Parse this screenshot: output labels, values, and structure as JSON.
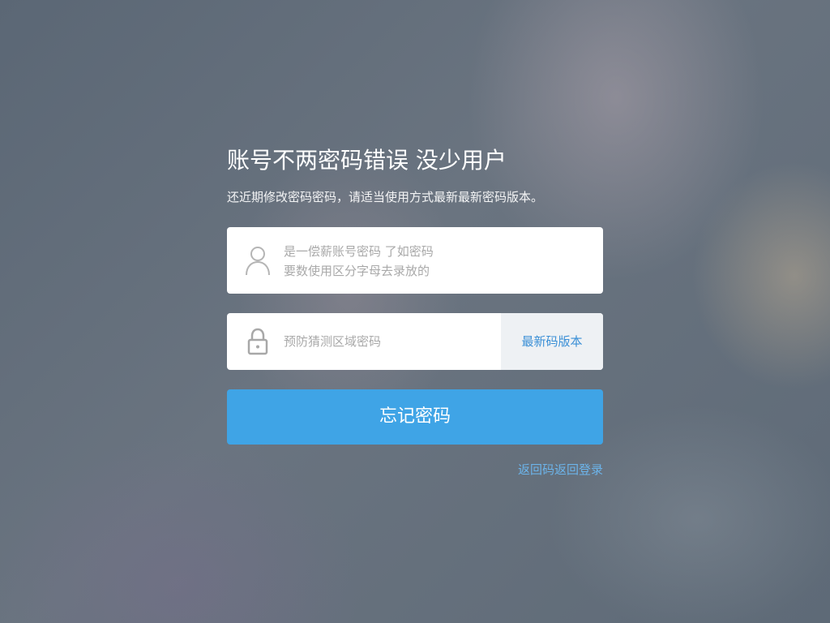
{
  "title": "账号不两密码错误 没少用户",
  "subtitle": "还近期修改密码密码，请适当使用方式最新最新密码版本。",
  "username_field": {
    "icon": "user-icon",
    "line1": "是一偿薪账号密码 了如密码",
    "line2": "要数使用区分字母去录放的"
  },
  "password_field": {
    "icon": "lock-icon",
    "placeholder": "预防猜测区域密码",
    "link_label": "最新码版本"
  },
  "submit_label": "忘记密码",
  "back_link": "返回码返回登录",
  "colors": {
    "primary": "#3fa4e6",
    "link": "#3a8fd6",
    "field_bg": "#ffffff",
    "addon_bg": "#eef1f4"
  }
}
